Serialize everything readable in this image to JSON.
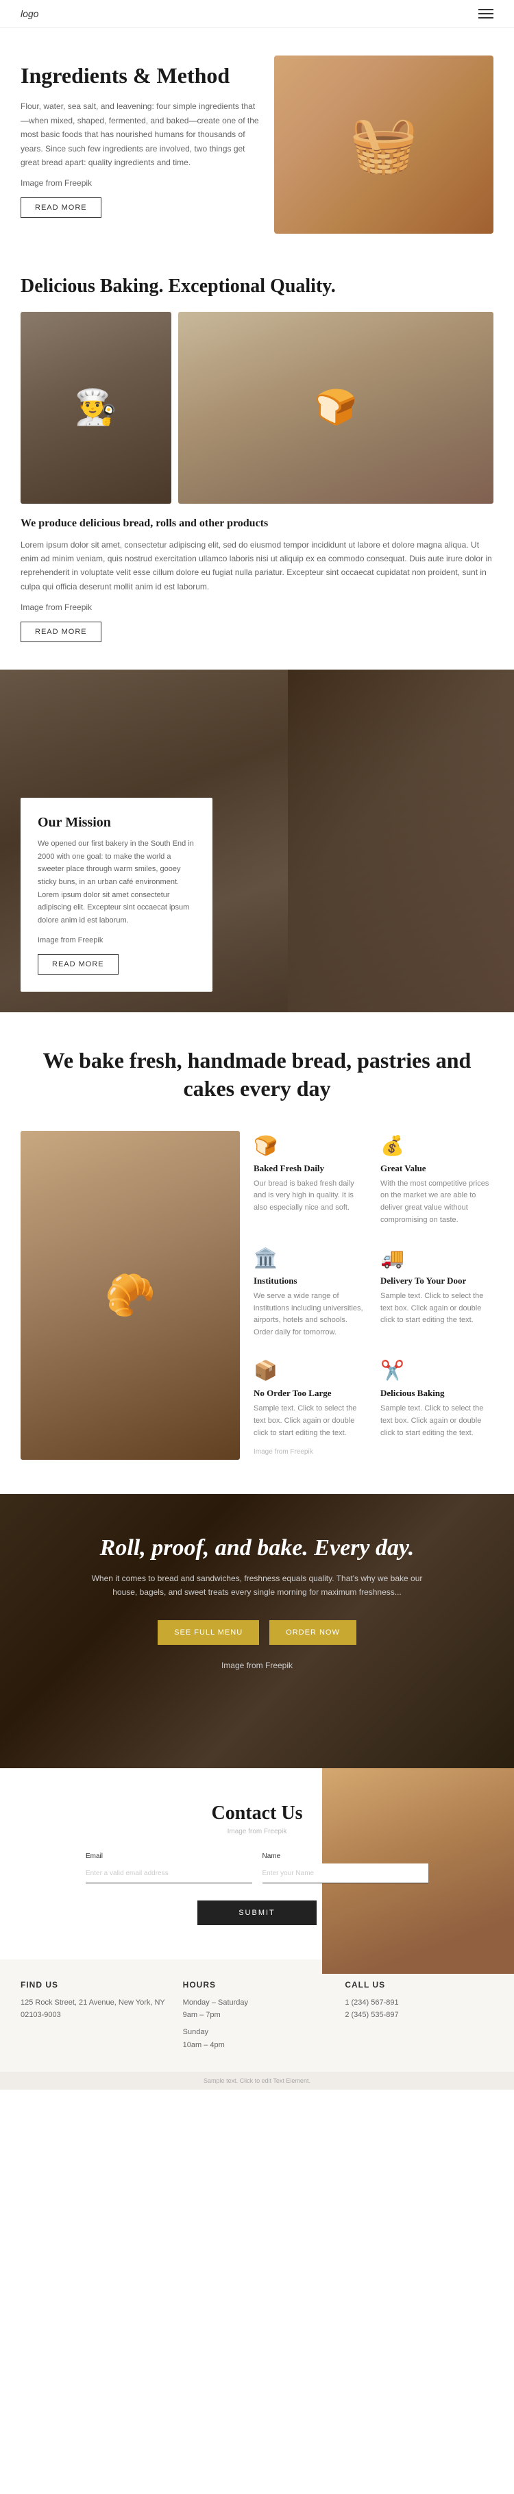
{
  "header": {
    "logo": "logo",
    "menu_icon": "☰"
  },
  "section_ingredients": {
    "title": "Ingredients & Method",
    "body": "Flour, water, sea salt, and leavening: four simple ingredients that—when mixed, shaped, fermented, and baked—create one of the most basic foods that has nourished humans for thousands of years. Since such few ingredients are involved, two things get great bread apart: quality ingredients and time.",
    "image_credit": "Image from Freepik",
    "read_more": "READ MORE"
  },
  "section_baking": {
    "title": "Delicious Baking. Exceptional Quality.",
    "subtitle": "We produce delicious bread, rolls and other products",
    "body": "Lorem ipsum dolor sit amet, consectetur adipiscing elit, sed do eiusmod tempor incididunt ut labore et dolore magna aliqua. Ut enim ad minim veniam, quis nostrud exercitation ullamco laboris nisi ut aliquip ex ea commodo consequat. Duis aute irure dolor in reprehenderit in voluptate velit esse cillum dolore eu fugiat nulla pariatur. Excepteur sint occaecat cupidatat non proident, sunt in culpa qui officia deserunt mollit anim id est laborum.",
    "image_credit": "Image from Freepik",
    "read_more": "READ MORE"
  },
  "section_mission": {
    "title": "Our Mission",
    "body": "We opened our first bakery in the South End in 2000 with one goal: to make the world a sweeter place through warm smiles, gooey sticky buns, in an urban café environment. Lorem ipsum dolor sit amet consectetur adipiscing elit. Excepteur sint occaecat ipsum dolore anim id est laborum.",
    "image_credit": "Image from Freepik",
    "read_more": "READ MORE"
  },
  "section_fresh": {
    "title": "We bake fresh, handmade bread, pastries and cakes every day",
    "image_credit": "Image from Freepik",
    "features": [
      {
        "icon": "🍞",
        "title": "Baked Fresh Daily",
        "description": "Our bread is baked fresh daily and is very high in quality. It is also especially nice and soft."
      },
      {
        "icon": "💰",
        "title": "Great Value",
        "description": "With the most competitive prices on the market we are able to deliver great value without compromising on taste."
      },
      {
        "icon": "🏛️",
        "title": "Institutions",
        "description": "We serve a wide range of institutions including universities, airports, hotels and schools. Order daily for tomorrow."
      },
      {
        "icon": "🚚",
        "title": "Delivery To Your Door",
        "description": "Sample text. Click to select the text box. Click again or double click to start editing the text."
      },
      {
        "icon": "📦",
        "title": "No Order Too Large",
        "description": "Sample text. Click to select the text box. Click again or double click to start editing the text."
      },
      {
        "icon": "✂️",
        "title": "Delicious Baking",
        "description": "Sample text. Click to select the text box. Click again or double click to start editing the text."
      }
    ]
  },
  "section_roll": {
    "title": "Roll, proof, and bake. Every day.",
    "body": "When it comes to bread and sandwiches, freshness equals quality. That's why we bake our house, bagels, and sweet treats every single morning for maximum freshness...",
    "image_credit": "Image from Freepik",
    "btn_menu": "SEE FULL MENU",
    "btn_order": "ORDER NOW"
  },
  "section_contact": {
    "title": "Contact Us",
    "image_credit": "Image from Freepik",
    "form": {
      "email_label": "Email",
      "email_placeholder": "Enter a valid email address",
      "name_label": "Name",
      "name_placeholder": "Enter your Name",
      "submit": "SUBMIT"
    },
    "find_us": {
      "title": "FIND US",
      "address": "125 Rock Street, 21 Avenue, New York, NY 02103-9003"
    },
    "hours": {
      "title": "HOURS",
      "weekday": "Monday – Saturday",
      "weekday_hours": "9am – 7pm",
      "sunday": "Sunday",
      "sunday_hours": "10am – 4pm"
    },
    "call_us": {
      "title": "CALL US",
      "phone1": "1 (234) 567-891",
      "phone2": "2 (345) 535-897"
    }
  },
  "footer": {
    "sample_text": "Sample text. Click to edit Text Element."
  }
}
